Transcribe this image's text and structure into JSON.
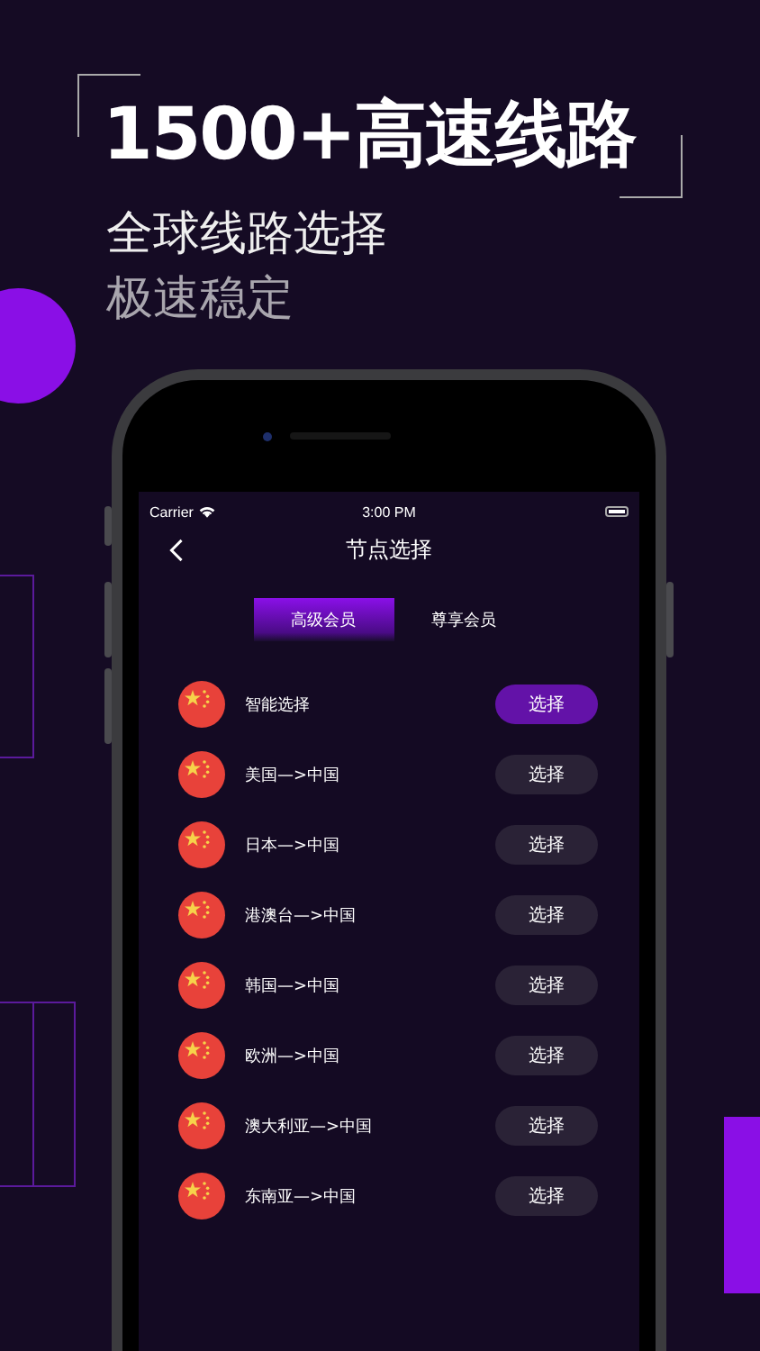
{
  "headline": {
    "title": "1500+高速线路",
    "subtitle": "全球线路选择",
    "tagline": "极速稳定"
  },
  "status_bar": {
    "carrier": "Carrier",
    "time": "3:00 PM"
  },
  "nav": {
    "title": "节点选择"
  },
  "tabs": [
    {
      "label": "高级会员",
      "selected": true
    },
    {
      "label": "尊享会员",
      "selected": false
    }
  ],
  "routes": [
    {
      "name": "智能选择",
      "button": {
        "label": "选择",
        "selected": true
      }
    },
    {
      "name": "美国—>中国",
      "button": {
        "label": "选择",
        "selected": false
      }
    },
    {
      "name": "日本—>中国",
      "button": {
        "label": "选择",
        "selected": false
      }
    },
    {
      "name": "港澳台—>中国",
      "button": {
        "label": "选择",
        "selected": false
      }
    },
    {
      "name": "韩国—>中国",
      "button": {
        "label": "选择",
        "selected": false
      }
    },
    {
      "name": "欧洲—>中国",
      "button": {
        "label": "选择",
        "selected": false
      }
    },
    {
      "name": "澳大利亚—>中国",
      "button": {
        "label": "选择",
        "selected": false
      }
    },
    {
      "name": "东南亚—>中国",
      "button": {
        "label": "选择",
        "selected": false
      }
    }
  ]
}
